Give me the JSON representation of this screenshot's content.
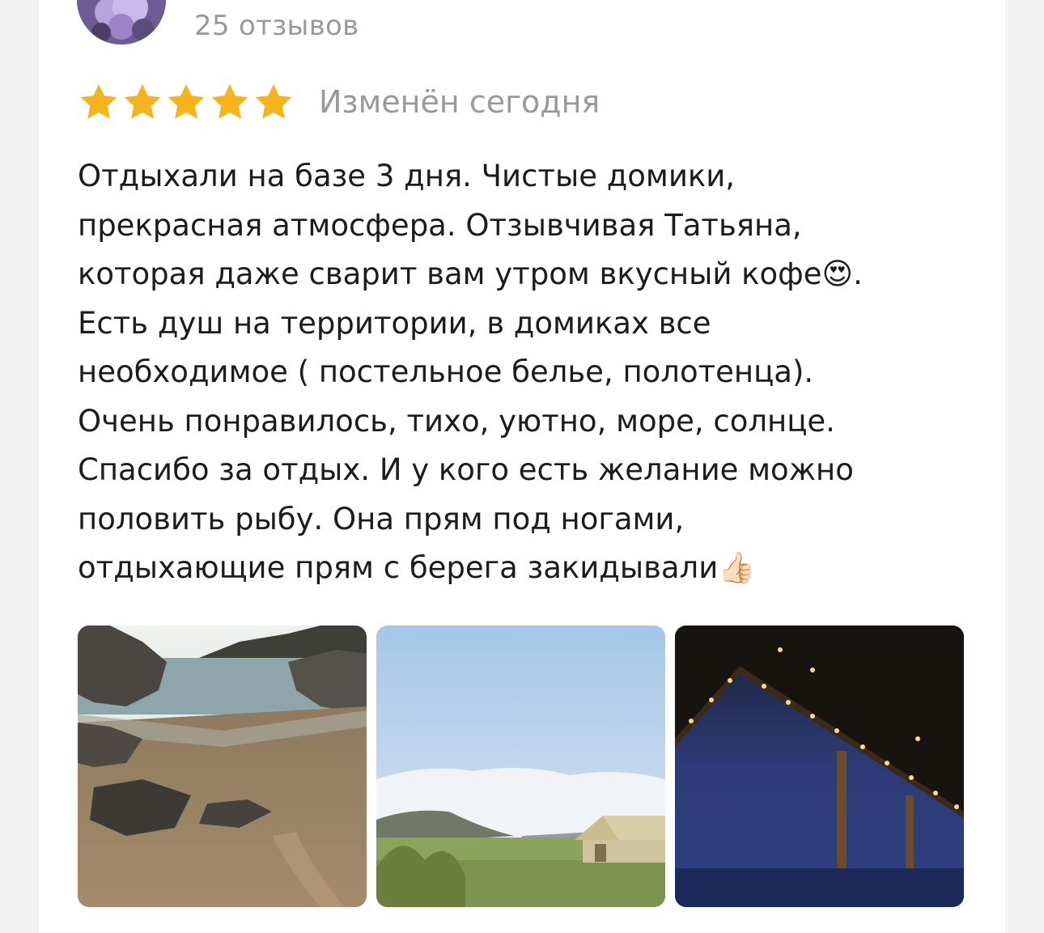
{
  "reviewer": {
    "reviews_count": "25 отзывов"
  },
  "rating": {
    "stars": 5,
    "max_stars": 5,
    "star_color": "#f6b31c",
    "edited_label": "Изменён сегодня"
  },
  "review": {
    "text": "Отдыхали на базе 3 дня. Чистые домики,\nпрекрасная атмосфера. Отзывчивая Татьяна,\nкоторая даже сварит вам утром вкусный кофе😍.\nЕсть душ на территории, в домиках все\nнеобходимое ( постельное белье, полотенца).\nОчень понравилось, тихо, уютно, море, солнце.\nСпасибо за отдых. И у кого есть желание можно\nполовить рыбу. Она прям под ногами,\nотдыхающие прям с берега закидывали👍🏻"
  },
  "photos": [
    {
      "icon": "beach-photo"
    },
    {
      "icon": "meadow-tent-photo"
    },
    {
      "icon": "night-canopy-photo"
    }
  ]
}
